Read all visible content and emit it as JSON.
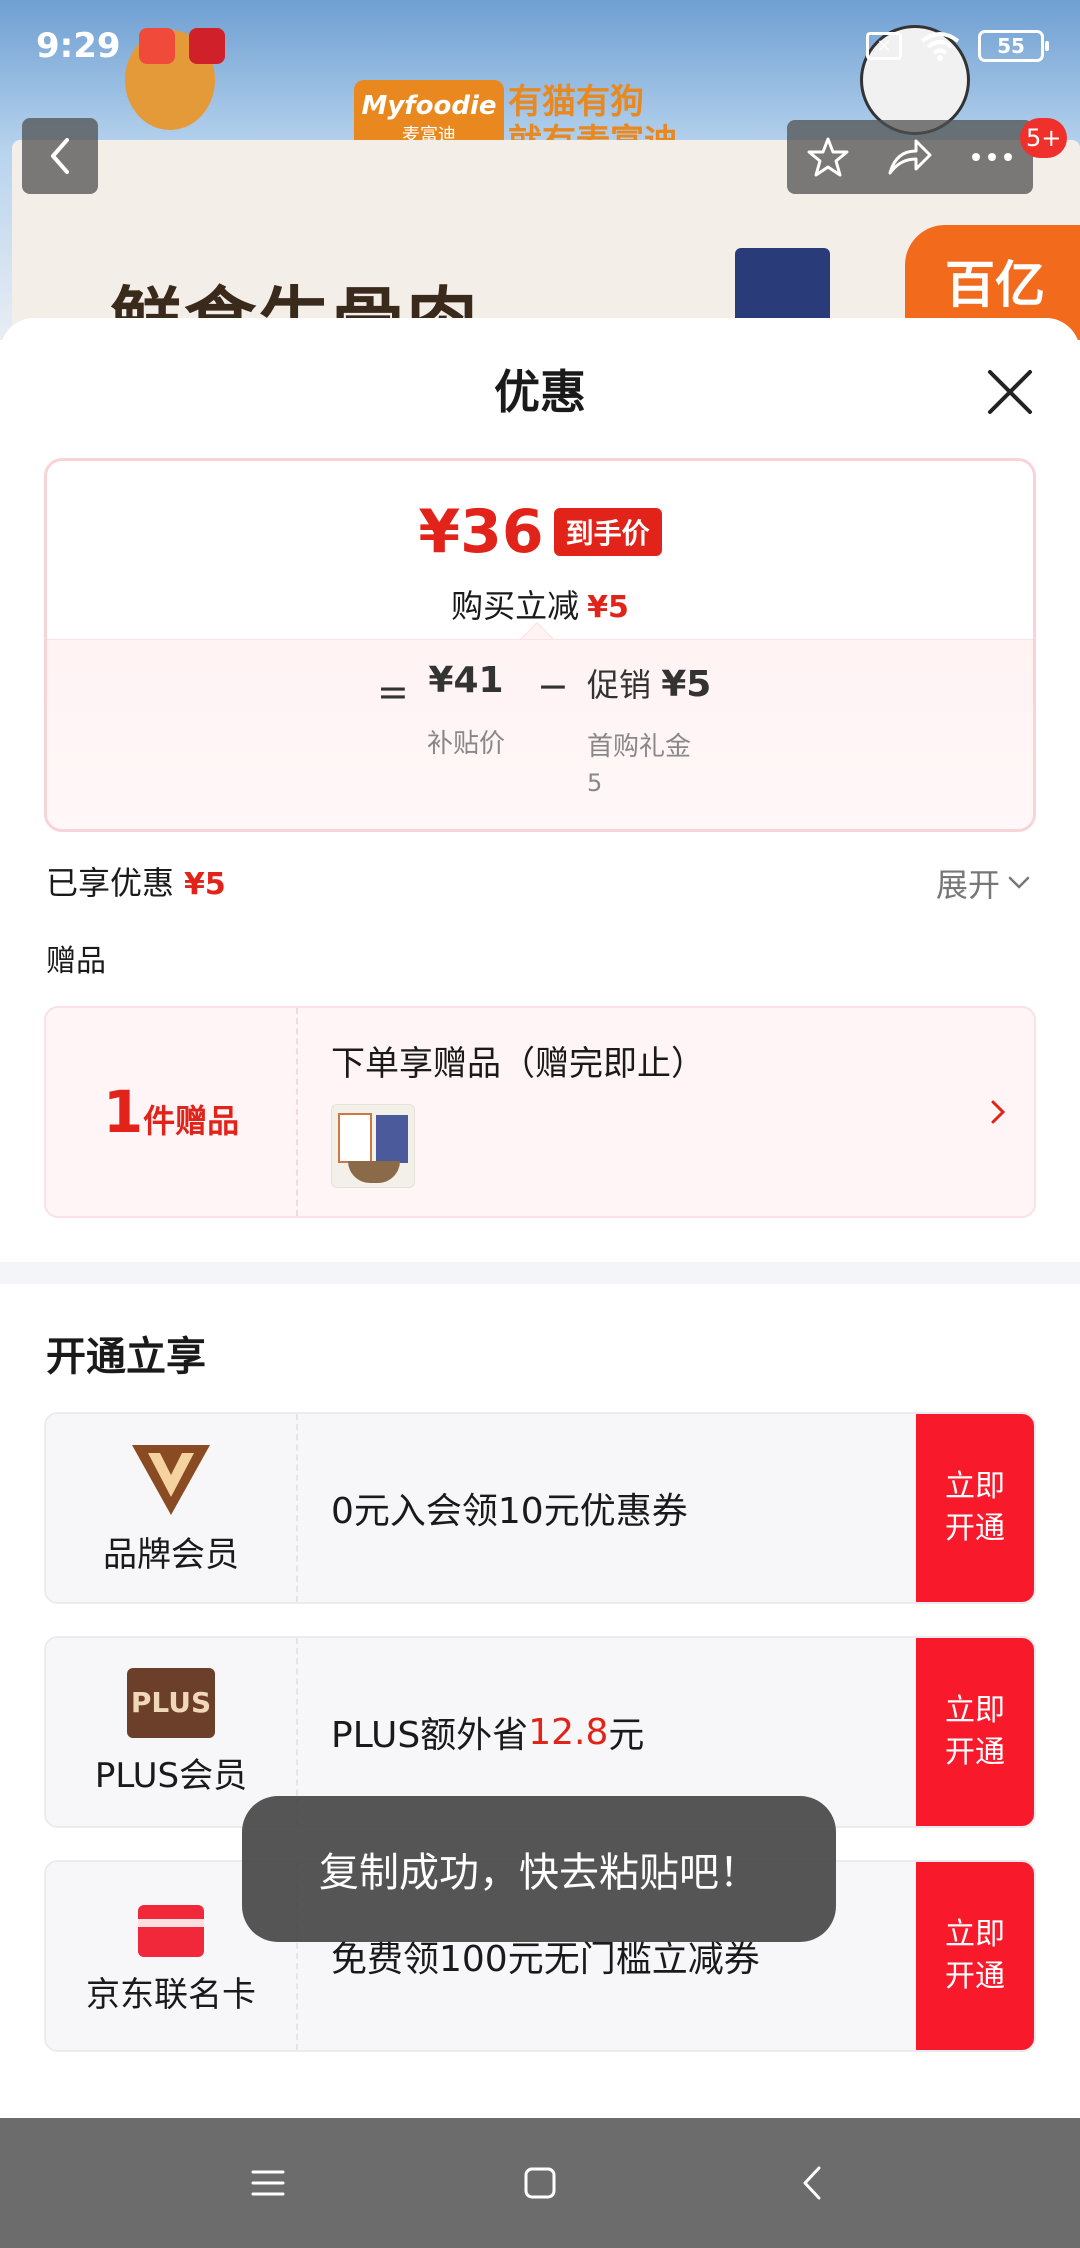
{
  "status_bar": {
    "time": "9:29",
    "battery": "55"
  },
  "background": {
    "brand_logo_line1": "Myfoodie",
    "brand_logo_line2": "麦富迪",
    "brand_slogan_line1": "有猫有狗",
    "brand_slogan_line2": "就有麦富迪",
    "banner_text": "鲜食生骨肉",
    "corner_badge": "百亿",
    "cart_badge": "5+"
  },
  "sheet": {
    "title": "优惠"
  },
  "price_card": {
    "final_price": "¥36",
    "final_price_tag": "到手价",
    "instant_discount_label": "购买立减",
    "instant_discount_value": "¥5",
    "subsidy_price": "¥41",
    "subsidy_price_label": "补贴价",
    "promo_label": "促销",
    "promo_value": "¥5",
    "first_purchase_label": "首购礼金",
    "first_purchase_value": "5"
  },
  "enjoyed": {
    "label": "已享优惠",
    "value": "¥5",
    "expand_label": "展开"
  },
  "gifts": {
    "section_label": "赠品",
    "count": "1",
    "unit": "件赠品",
    "title": "下单享赠品（赠完即止）"
  },
  "membership": {
    "section_title": "开通立享",
    "cards": [
      {
        "name": "品牌会员",
        "desc": "0元入会领10元优惠券",
        "button": "立即开通"
      },
      {
        "name": "PLUS会员",
        "desc_prefix": "PLUS额外省",
        "desc_highlight": "12.8",
        "desc_suffix": "元",
        "icon_text": "PLUS",
        "button": "立即开通"
      },
      {
        "name": "京东联名卡",
        "desc": "免费领100元无门槛立减券",
        "button": "立即开通"
      }
    ]
  },
  "toast": {
    "message": "复制成功，快去粘贴吧！"
  },
  "colors": {
    "accent_red": "#e2231a",
    "button_red": "#f81a2a",
    "toast_bg": "#464646",
    "nav_bar_bg": "#6c6c6c"
  }
}
